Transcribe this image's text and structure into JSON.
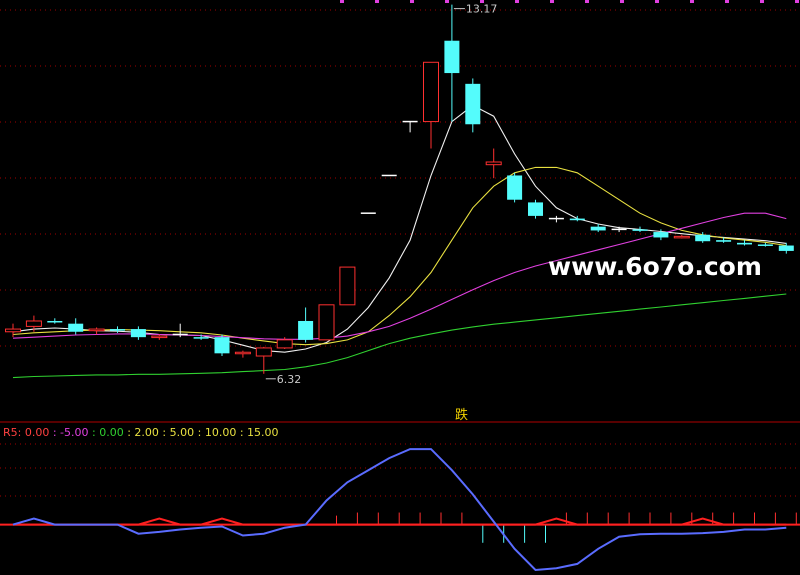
{
  "chart_data": {
    "type": "candlestick",
    "watermark": "www.6o7o.com",
    "high_annotation": "13.17",
    "low_annotation": "6.32",
    "divider_label": "跌",
    "price_range": [
      5.5,
      13.2
    ],
    "candles": [
      {
        "o": 7.1,
        "h": 7.25,
        "l": 7.0,
        "c": 7.15
      },
      {
        "o": 7.2,
        "h": 7.4,
        "l": 7.1,
        "c": 7.3
      },
      {
        "o": 7.3,
        "h": 7.35,
        "l": 7.25,
        "c": 7.28
      },
      {
        "o": 7.25,
        "h": 7.35,
        "l": 7.05,
        "c": 7.1
      },
      {
        "o": 7.12,
        "h": 7.18,
        "l": 7.05,
        "c": 7.15
      },
      {
        "o": 7.15,
        "h": 7.2,
        "l": 7.08,
        "c": 7.12
      },
      {
        "o": 7.15,
        "h": 7.2,
        "l": 6.95,
        "c": 7.0
      },
      {
        "o": 7.0,
        "h": 7.05,
        "l": 6.95,
        "c": 7.02
      },
      {
        "o": 7.05,
        "h": 7.25,
        "l": 7.0,
        "c": 7.05
      },
      {
        "o": 7.0,
        "h": 7.05,
        "l": 6.95,
        "c": 6.98
      },
      {
        "o": 7.0,
        "h": 7.05,
        "l": 6.65,
        "c": 6.7
      },
      {
        "o": 6.7,
        "h": 6.75,
        "l": 6.62,
        "c": 6.72
      },
      {
        "o": 6.65,
        "h": 6.82,
        "l": 6.32,
        "c": 6.8
      },
      {
        "o": 6.8,
        "h": 7.0,
        "l": 6.78,
        "c": 6.95
      },
      {
        "o": 7.3,
        "h": 7.55,
        "l": 6.9,
        "c": 6.95
      },
      {
        "o": 6.95,
        "h": 7.6,
        "l": 6.95,
        "c": 7.6
      },
      {
        "o": 7.6,
        "h": 8.3,
        "l": 7.6,
        "c": 8.3
      },
      {
        "o": 9.3,
        "h": 9.3,
        "l": 9.3,
        "c": 9.3
      },
      {
        "o": 10.0,
        "h": 10.0,
        "l": 10.0,
        "c": 10.0
      },
      {
        "o": 11.0,
        "h": 11.0,
        "l": 10.8,
        "c": 11.0
      },
      {
        "o": 11.0,
        "h": 12.1,
        "l": 10.5,
        "c": 12.1
      },
      {
        "o": 12.5,
        "h": 13.17,
        "l": 11.0,
        "c": 11.9
      },
      {
        "o": 11.7,
        "h": 11.8,
        "l": 10.8,
        "c": 10.95
      },
      {
        "o": 10.2,
        "h": 10.5,
        "l": 9.95,
        "c": 10.25
      },
      {
        "o": 10.0,
        "h": 10.05,
        "l": 9.5,
        "c": 9.55
      },
      {
        "o": 9.5,
        "h": 9.55,
        "l": 9.2,
        "c": 9.25
      },
      {
        "o": 9.2,
        "h": 9.25,
        "l": 9.13,
        "c": 9.2
      },
      {
        "o": 9.2,
        "h": 9.25,
        "l": 9.15,
        "c": 9.17
      },
      {
        "o": 9.05,
        "h": 9.1,
        "l": 8.95,
        "c": 8.98
      },
      {
        "o": 9.0,
        "h": 9.05,
        "l": 8.95,
        "c": 9.0
      },
      {
        "o": 9.0,
        "h": 9.05,
        "l": 8.95,
        "c": 8.98
      },
      {
        "o": 8.95,
        "h": 9.0,
        "l": 8.8,
        "c": 8.85
      },
      {
        "o": 8.85,
        "h": 8.9,
        "l": 8.83,
        "c": 8.87
      },
      {
        "o": 8.9,
        "h": 8.95,
        "l": 8.75,
        "c": 8.78
      },
      {
        "o": 8.8,
        "h": 8.85,
        "l": 8.75,
        "c": 8.77
      },
      {
        "o": 8.75,
        "h": 8.8,
        "l": 8.7,
        "c": 8.72
      },
      {
        "o": 8.72,
        "h": 8.75,
        "l": 8.68,
        "c": 8.7
      },
      {
        "o": 8.7,
        "h": 8.75,
        "l": 8.55,
        "c": 8.6
      }
    ],
    "ma_series": [
      {
        "color": "#f0f0f0",
        "values": [
          7.1,
          7.15,
          7.17,
          7.15,
          7.12,
          7.11,
          7.09,
          7.05,
          7.04,
          7.03,
          6.95,
          6.85,
          6.75,
          6.72,
          6.78,
          6.9,
          7.15,
          7.55,
          8.1,
          8.8,
          10.0,
          11.0,
          11.3,
          11.1,
          10.4,
          9.8,
          9.4,
          9.2,
          9.1,
          9.03,
          9.0,
          8.96,
          8.92,
          8.88,
          8.85,
          8.82,
          8.79,
          8.74
        ]
      },
      {
        "color": "#e8e040",
        "values": [
          7.05,
          7.08,
          7.1,
          7.12,
          7.13,
          7.14,
          7.13,
          7.12,
          7.1,
          7.08,
          7.04,
          6.98,
          6.93,
          6.88,
          6.86,
          6.88,
          6.95,
          7.1,
          7.4,
          7.75,
          8.2,
          8.8,
          9.4,
          9.8,
          10.05,
          10.15,
          10.15,
          10.05,
          9.8,
          9.55,
          9.3,
          9.12,
          8.98,
          8.9,
          8.84,
          8.8,
          8.76,
          8.7
        ]
      },
      {
        "color": "#e040e0",
        "values": [
          6.98,
          7.0,
          7.02,
          7.04,
          7.05,
          7.06,
          7.06,
          7.05,
          7.04,
          7.03,
          7.01,
          6.99,
          6.97,
          6.96,
          6.96,
          6.98,
          7.02,
          7.1,
          7.2,
          7.35,
          7.52,
          7.7,
          7.88,
          8.05,
          8.2,
          8.32,
          8.42,
          8.52,
          8.62,
          8.72,
          8.82,
          8.92,
          9.02,
          9.12,
          9.22,
          9.3,
          9.3,
          9.2
        ]
      },
      {
        "color": "#30d030",
        "values": [
          6.25,
          6.27,
          6.28,
          6.29,
          6.3,
          6.3,
          6.31,
          6.31,
          6.32,
          6.33,
          6.34,
          6.36,
          6.38,
          6.4,
          6.45,
          6.52,
          6.62,
          6.75,
          6.88,
          6.98,
          7.06,
          7.13,
          7.19,
          7.24,
          7.28,
          7.32,
          7.36,
          7.4,
          7.44,
          7.48,
          7.52,
          7.56,
          7.6,
          7.64,
          7.68,
          7.72,
          7.76,
          7.8
        ]
      }
    ],
    "indicator": {
      "name": "R5",
      "legend": [
        {
          "label": "R5: 0.00",
          "color": "#ff4040"
        },
        {
          "label": ": -5.00",
          "color": "#e040e0"
        },
        {
          "label": ": 0.00",
          "color": "#30d030"
        },
        {
          "label": ": 2.00",
          "color": "#e8e040"
        },
        {
          "label": ": 5.00",
          "color": "#e8e040"
        },
        {
          "label": ": 10.00",
          "color": "#e8e040"
        },
        {
          "label": ": 15.00",
          "color": "#e8e040"
        }
      ],
      "range": [
        -8,
        14
      ],
      "line_values": [
        0,
        1,
        0,
        0,
        0,
        0,
        -1.5,
        -1.2,
        -0.8,
        -0.5,
        -0.3,
        -1.8,
        -1.5,
        -0.5,
        0,
        4,
        7,
        9,
        11,
        12.5,
        12.5,
        9,
        5,
        0.5,
        -4,
        -7.5,
        -7.2,
        -6.5,
        -4,
        -2,
        -1.6,
        -1.5,
        -1.5,
        -1.4,
        -1.2,
        -0.8,
        -0.8,
        -0.5
      ],
      "red_values": [
        0,
        0,
        0,
        0,
        0,
        0,
        0,
        1,
        0,
        0,
        1,
        0,
        0,
        0,
        0,
        0,
        0,
        0,
        0,
        0,
        0,
        0,
        0,
        0,
        0,
        0,
        1,
        0,
        0,
        0,
        0,
        0,
        0,
        1,
        0,
        0,
        0,
        0
      ],
      "bars": [
        0,
        0,
        0,
        0,
        0,
        0,
        0,
        0,
        0,
        0,
        0,
        0,
        0,
        0,
        0,
        1.5,
        2,
        2,
        2,
        2,
        2,
        2,
        -3,
        -3,
        -3,
        -3,
        2,
        2,
        2,
        2,
        2,
        2,
        2,
        2,
        2,
        2,
        2,
        2
      ]
    }
  }
}
